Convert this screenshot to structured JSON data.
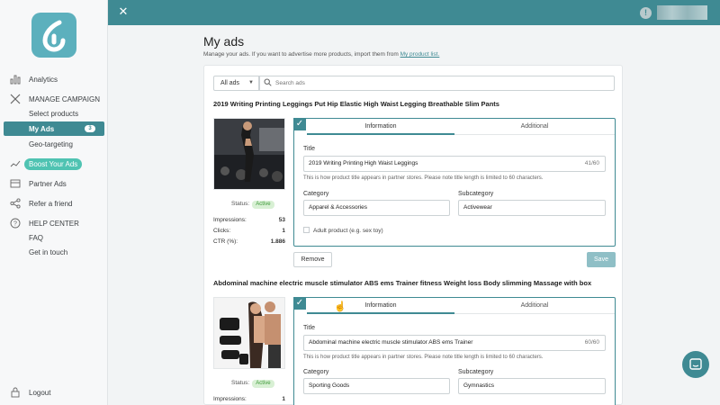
{
  "sidebar": {
    "items": [
      {
        "label": "Analytics",
        "icon": "bar-chart-icon"
      },
      {
        "label": "MANAGE CAMPAIGN",
        "icon": "tools-icon"
      },
      {
        "label": "Select products"
      },
      {
        "label": "My Ads",
        "badge": "3"
      },
      {
        "label": "Geo-targeting"
      },
      {
        "label": "Boost Your Ads",
        "icon": "trend-icon"
      },
      {
        "label": "Partner Ads",
        "icon": "partner-icon"
      },
      {
        "label": "Refer a friend",
        "icon": "share-icon"
      },
      {
        "label": "HELP CENTER",
        "icon": "help-icon"
      },
      {
        "label": "FAQ"
      },
      {
        "label": "Get in touch"
      },
      {
        "label": "Logout",
        "icon": "lock-icon"
      }
    ]
  },
  "header": {
    "title": "My ads",
    "subtitle": "Manage your ads. If you want to advertise more products, import them from",
    "subtitle_link": "My product list."
  },
  "filter": {
    "selected": "All ads",
    "search_placeholder": "Search ads"
  },
  "tabs": {
    "information": "Information",
    "additional": "Additional"
  },
  "labels": {
    "title": "Title",
    "hint": "This is how product title appears in partner stores. Please note title length is limited to 60 characters.",
    "category": "Category",
    "subcategory": "Subcategory",
    "adult": "Adult product (e.g. sex toy)",
    "status": "Status:",
    "impressions": "Impressions:",
    "clicks": "Clicks:",
    "ctr": "CTR (%):",
    "remove": "Remove",
    "save": "Save"
  },
  "products": [
    {
      "name": "2019 Writing Printing Leggings Put Hip Elastic High Waist Legging Breathable Slim Pants",
      "status": "Active",
      "impressions": "53",
      "clicks": "1",
      "ctr": "1.886",
      "title_value": "2019 Writing Printing High Waist Leggings",
      "title_count": "41/60",
      "category": "Apparel & Accessories",
      "subcategory": "Activewear"
    },
    {
      "name": "Abdominal machine electric muscle stimulator ABS ems Trainer fitness Weight loss Body slimming Massage with box",
      "status": "Active",
      "impressions": "1",
      "title_value": "Abdominal machine electric muscle stimulator ABS ems Trainer",
      "title_count": "60/60",
      "category": "Sporting Goods",
      "subcategory": "Gymnastics"
    }
  ],
  "colors": {
    "primary": "#3f8a93",
    "accent": "#4fc3b2",
    "active_badge": "#d8f0d4"
  }
}
